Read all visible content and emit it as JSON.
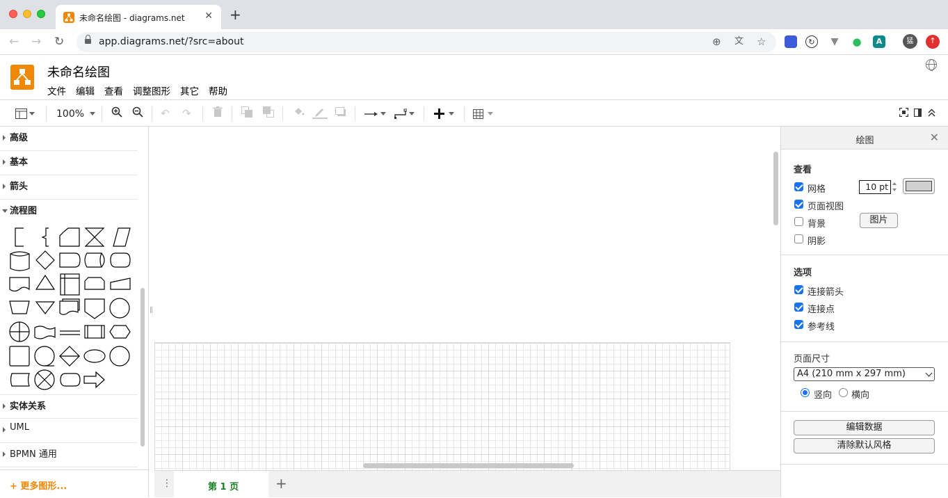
{
  "browser": {
    "tab_title": "未命名绘图 - diagrams.net",
    "tab_close": "✕",
    "new_tab": "+",
    "url": "app.diagrams.net/?src=about",
    "profile_initial": "猛"
  },
  "app": {
    "doc_title": "未命名绘图",
    "menu": [
      "文件",
      "编辑",
      "查看",
      "调整图形",
      "其它",
      "帮助"
    ],
    "accent_color": "#f08705"
  },
  "toolbar": {
    "zoom": "100%"
  },
  "sidebar": {
    "sections": [
      {
        "label": "高级",
        "open": false
      },
      {
        "label": "基本",
        "open": false
      },
      {
        "label": "箭头",
        "open": false
      },
      {
        "label": "流程图",
        "open": true
      },
      {
        "label": "实体关系",
        "open": false
      },
      {
        "label": "UML",
        "open": false
      },
      {
        "label": "BPMN 通用",
        "open": false
      }
    ],
    "more_shapes": "+ 更多图形..."
  },
  "pages": {
    "tabs": [
      "第 1 页"
    ],
    "add": "+"
  },
  "panel": {
    "title": "绘图",
    "close": "✕",
    "view": {
      "title": "查看",
      "grid": {
        "label": "网格",
        "checked": true,
        "size": "10 pt"
      },
      "page_view": {
        "label": "页面视图",
        "checked": true
      },
      "background": {
        "label": "背景",
        "checked": false,
        "button": "图片"
      },
      "shadow": {
        "label": "阴影",
        "checked": false
      }
    },
    "options": {
      "title": "选项",
      "connection_arrows": {
        "label": "连接箭头",
        "checked": true
      },
      "connection_points": {
        "label": "连接点",
        "checked": true
      },
      "guides": {
        "label": "参考线",
        "checked": true
      }
    },
    "paper": {
      "title": "页面尺寸",
      "size": "A4 (210 mm x 297 mm)",
      "portrait": {
        "label": "竖向",
        "checked": true
      },
      "landscape": {
        "label": "横向",
        "checked": false
      }
    },
    "actions": {
      "edit_data": "编辑数据",
      "clear_default_style": "清除默认风格"
    }
  }
}
